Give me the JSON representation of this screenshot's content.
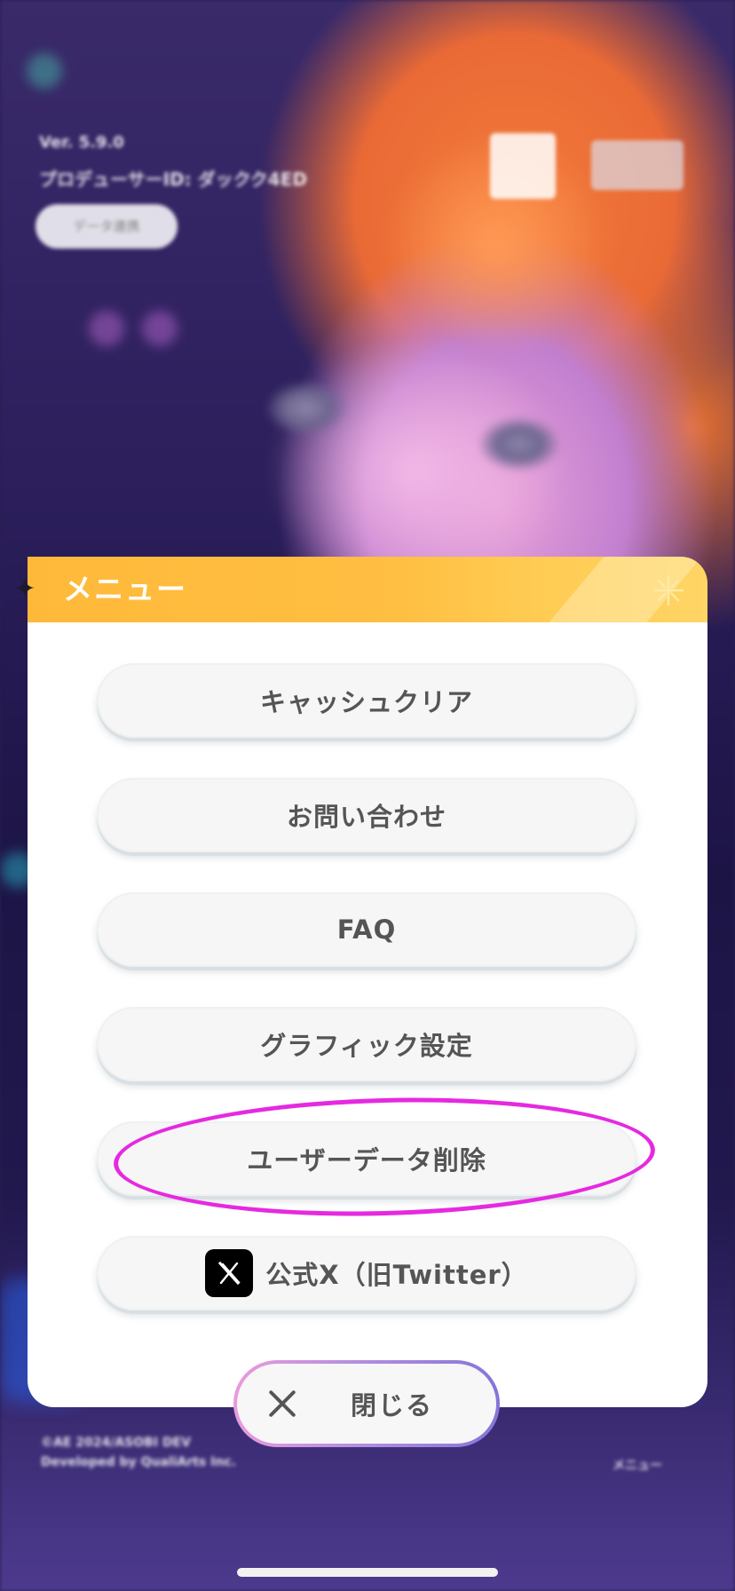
{
  "background": {
    "version_text": "Ver. 5.9.0",
    "producer_text": "プロデューサーID: ダックク4ED",
    "pill_text": "データ連携",
    "copyright_line1": "©AE 2024/ASOBI DEV",
    "copyright_line2": "Developed by QualiArts Inc.",
    "menu_label": "メニュー"
  },
  "dialog": {
    "title": "メニュー",
    "items": [
      {
        "label": "キャッシュクリア"
      },
      {
        "label": "お問い合わせ"
      },
      {
        "label": "FAQ"
      },
      {
        "label": "グラフィック設定"
      },
      {
        "label": "ユーザーデータ削除"
      },
      {
        "label": "公式X（旧Twitter）",
        "icon": "x-logo-icon"
      }
    ],
    "close_label": "閉じる"
  },
  "colors": {
    "header": "#ffbb3d",
    "highlight": "#e629e0",
    "button_text": "#555555"
  }
}
